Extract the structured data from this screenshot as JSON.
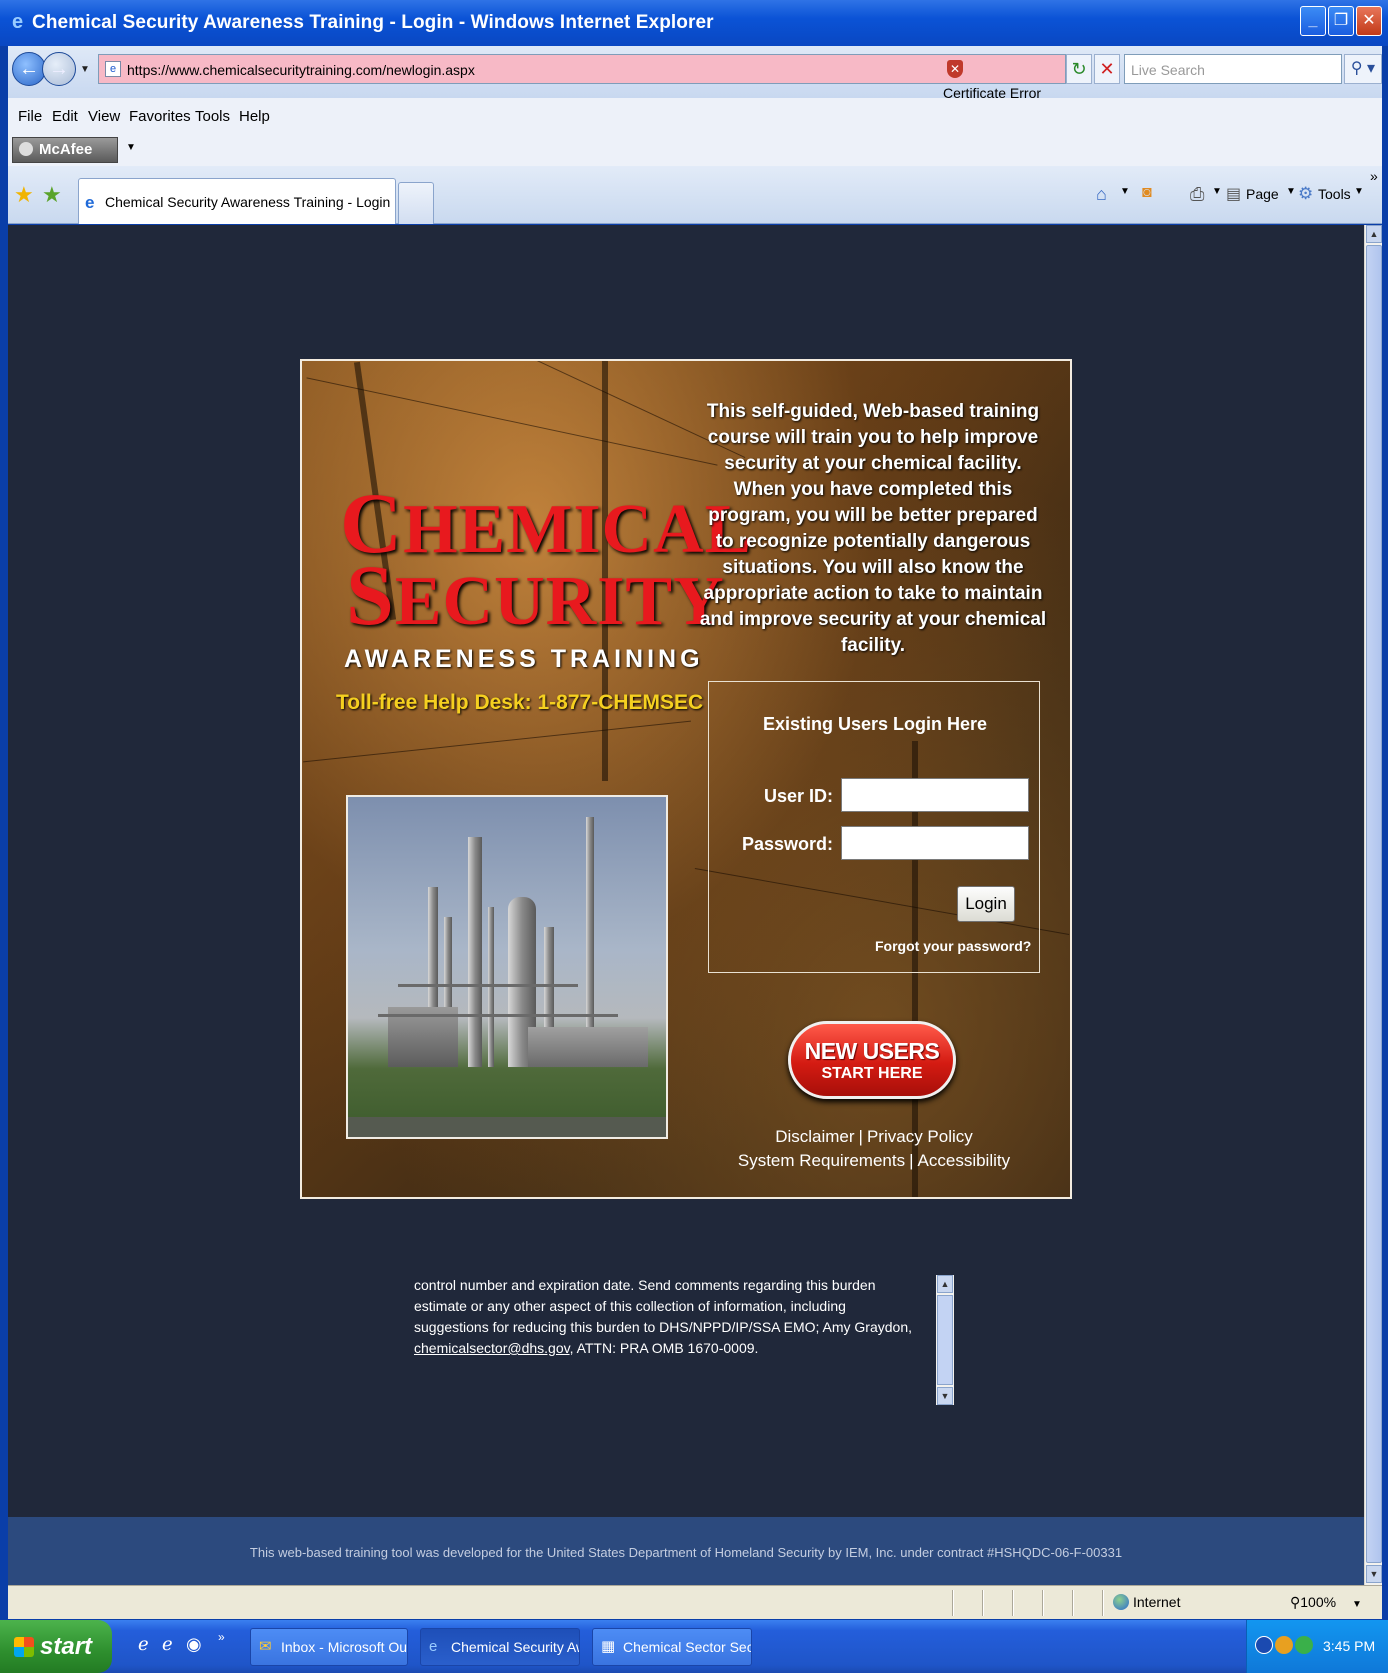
{
  "window": {
    "title": "Chemical Security Awareness Training - Login - Windows Internet Explorer",
    "controls": [
      "minimize",
      "restore",
      "close"
    ]
  },
  "address": {
    "url": "https://www.chemicalsecuritytraining.com/newlogin.aspx",
    "certificate_error": "Certificate Error",
    "search_placeholder": "Live Search"
  },
  "menu": [
    "File",
    "Edit",
    "View",
    "Favorites",
    "Tools",
    "Help"
  ],
  "mcafee": {
    "label": "McAfee"
  },
  "tab": {
    "label": "Chemical Security Awareness Training - Login"
  },
  "command_bar": {
    "page": "Page",
    "tools": "Tools"
  },
  "brand": {
    "title_line1_first": "C",
    "title_line1_rest": "HEMICAL",
    "title_line2_first": "S",
    "title_line2_rest": "ECURITY",
    "subtitle": "AWARENESS TRAINING",
    "helpdesk": "Toll-free Help Desk: 1-877-CHEMSEC"
  },
  "intro": "This self-guided, Web-based training course will train you to help improve security at your chemical facility. When you have completed this program, you will be better prepared to recognize potentially dangerous situations. You will also know the appropriate action to take to maintain and improve security at your chemical facility.",
  "login": {
    "heading": "Existing Users Login Here",
    "user_id_label": "User ID:",
    "password_label": "Password:",
    "user_id_value": "",
    "password_value": "",
    "login_button": "Login",
    "forgot_password": "Forgot your password?"
  },
  "new_users": {
    "line1": "NEW USERS",
    "line2": "START HERE"
  },
  "links": {
    "disclaimer": "Disclaimer",
    "privacy": "Privacy Policy",
    "system_requirements": "System Requirements",
    "accessibility": "Accessibility",
    "separator": "|"
  },
  "notice": {
    "text_before_link": "control number and expiration date. Send comments regarding this burden estimate or any other aspect of this collection of information, including suggestions for reducing this burden to DHS/NPPD/IP/SSA EMO; Amy Graydon,",
    "email": "chemicalsector@dhs.gov",
    "text_after_link": ", ATTN: PRA OMB 1670-0009."
  },
  "footer": "This web-based training tool was developed for the United States Department of Homeland Security by IEM, Inc. under contract #HSHQDC-06-F-00331",
  "status": {
    "zone": "Internet",
    "zoom": "100%"
  },
  "taskbar": {
    "start": "start",
    "tasks": [
      {
        "label": "Inbox - Microsoft Out...",
        "active": false
      },
      {
        "label": "Chemical Security Aw...",
        "active": true
      },
      {
        "label": "Chemical Sector Secu...",
        "active": false
      }
    ],
    "clock": "3:45 PM"
  },
  "colors": {
    "title_red": "#e8191e",
    "helpdesk_yellow": "#f5d020",
    "page_background": "#20283a",
    "footer_blue": "#2c4a7e",
    "url_bar_error_pink": "#f7b9c6"
  }
}
